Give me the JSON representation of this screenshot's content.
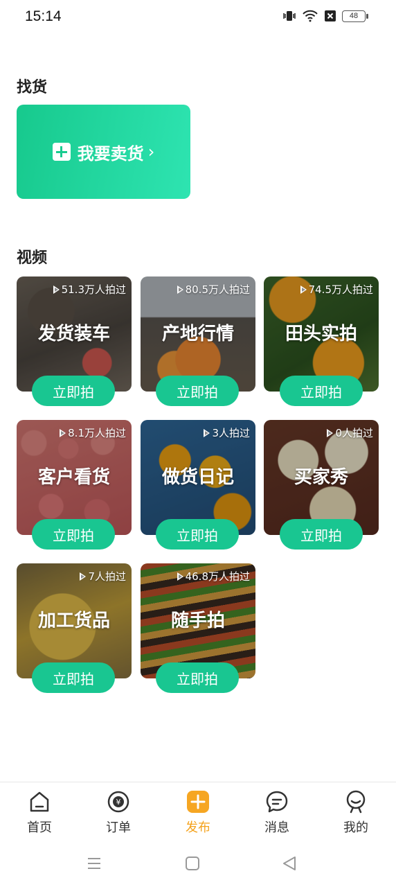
{
  "status_bar": {
    "time": "15:14",
    "battery": "48"
  },
  "find": {
    "title": "找货",
    "sell_label": "我要卖货",
    "chevron": "›"
  },
  "video": {
    "title": "视频",
    "cards": [
      {
        "title": "发货装车",
        "count": "51.3万人拍过",
        "button": "立即拍"
      },
      {
        "title": "产地行情",
        "count": "80.5万人拍过",
        "button": "立即拍"
      },
      {
        "title": "田头实拍",
        "count": "74.5万人拍过",
        "button": "立即拍"
      },
      {
        "title": "客户看货",
        "count": "8.1万人拍过",
        "button": "立即拍"
      },
      {
        "title": "做货日记",
        "count": "3人拍过",
        "button": "立即拍"
      },
      {
        "title": "买家秀",
        "count": "0人拍过",
        "button": "立即拍"
      },
      {
        "title": "加工货品",
        "count": "7人拍过",
        "button": "立即拍"
      },
      {
        "title": "随手拍",
        "count": "46.8万人拍过",
        "button": "立即拍"
      }
    ]
  },
  "bottom_nav": {
    "items": [
      {
        "label": "首页",
        "icon": "home-icon"
      },
      {
        "label": "订单",
        "icon": "order-icon"
      },
      {
        "label": "发布",
        "icon": "publish-icon",
        "active": true
      },
      {
        "label": "消息",
        "icon": "message-icon"
      },
      {
        "label": "我的",
        "icon": "profile-icon"
      }
    ]
  },
  "colors": {
    "accent_green": "#19c691",
    "active_orange": "#f4a21c"
  }
}
